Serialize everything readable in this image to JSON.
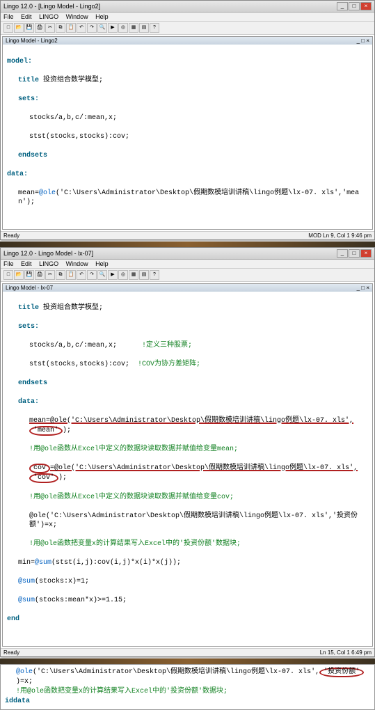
{
  "win1": {
    "title": "Lingo 12.0 - [Lingo Model - Lingo2]",
    "innerTitle": "Lingo Model - Lingo2",
    "menus": [
      "File",
      "Edit",
      "LINGO",
      "Window",
      "Help"
    ],
    "code": {
      "l1": "model:",
      "l2": "title 投资组合数学模型;",
      "l3": "sets:",
      "l4": "stocks/a,b,c/:mean,x;",
      "l5": "stst(stocks,stocks):cov;",
      "l6": "endsets",
      "l7": "data:",
      "l8a": "mean=",
      "l8fn": "@ole",
      "l8b": "('C:\\Users\\Administrator\\Desktop\\假期数模培训讲稿\\lingo例题\\lx-07. xls','mean');"
    },
    "status": {
      "l": "Ready",
      "r": "MOD   Ln 9, Col 1   9:46 pm"
    }
  },
  "win2": {
    "title": "Lingo 12.0 - Lingo Model - lx-07]",
    "innerTitle": "Lingo Model - lx-07",
    "code": {
      "l1": "title 投资组合数学模型;",
      "l2": "sets:",
      "l3a": "stocks/a,b,c/:mean,x;",
      "l3c": "!定义三种股票;",
      "l4a": "stst(stocks,stocks):cov;",
      "l4c": "!COV为协方差矩阵;",
      "l5": "endsets",
      "l6": "data:",
      "l7a": "mean=@ole('C:\\Users\\Administrator\\Desktop\\假期数模培训讲稿\\lingo例题\\lx-07. xls',",
      "l7b": "'mean'",
      "l7c": ");",
      "l8": "!用@ole函数从Excel中定义的数据块读取数据并赋值给变量mean;",
      "l9a": "cov",
      "l9b": "=@ole('C:\\Users\\Administrator\\Desktop\\假期数模培训讲稿\\lingo例题\\lx-07. xls',",
      "l9c": "'cov'",
      "l9d": ");",
      "l10": "!用@ole函数从Excel中定义的数据块读取数据并赋值给变量cov;",
      "l11": "@ole('C:\\Users\\Administrator\\Desktop\\假期数模培训讲稿\\lingo例题\\lx-07. xls','投资份额')=x;",
      "l12": "!用@ole函数把变量x的计算结果写入Excel中的'投资份额'数据块;",
      "l13a": "min=",
      "l13fn": "@sum",
      "l13b": "(stst(i,j):cov(i,j)*x(i)*x(j));",
      "l14fn": "@sum",
      "l14b": "(stocks:x)=1;",
      "l15fn": "@sum",
      "l15b": "(stocks:mean*x)>=1.15;",
      "l16": "end"
    },
    "status": {
      "l": "Ready",
      "r": "Ln 15, Col 1   6:49 pm"
    }
  },
  "extra": {
    "l1a": "@ole",
    "l1b": "('C:\\Users\\Administrator\\Desktop\\假期数模培训讲稿\\lingo例题\\lx-07. xls',",
    "l1c": "'投资份额'",
    "l1d": ")=x;",
    "l2": "!用@ole函数把变量x的计算结果写入Excel中的'投资份额'数据块;",
    "l3": "iddata"
  }
}
